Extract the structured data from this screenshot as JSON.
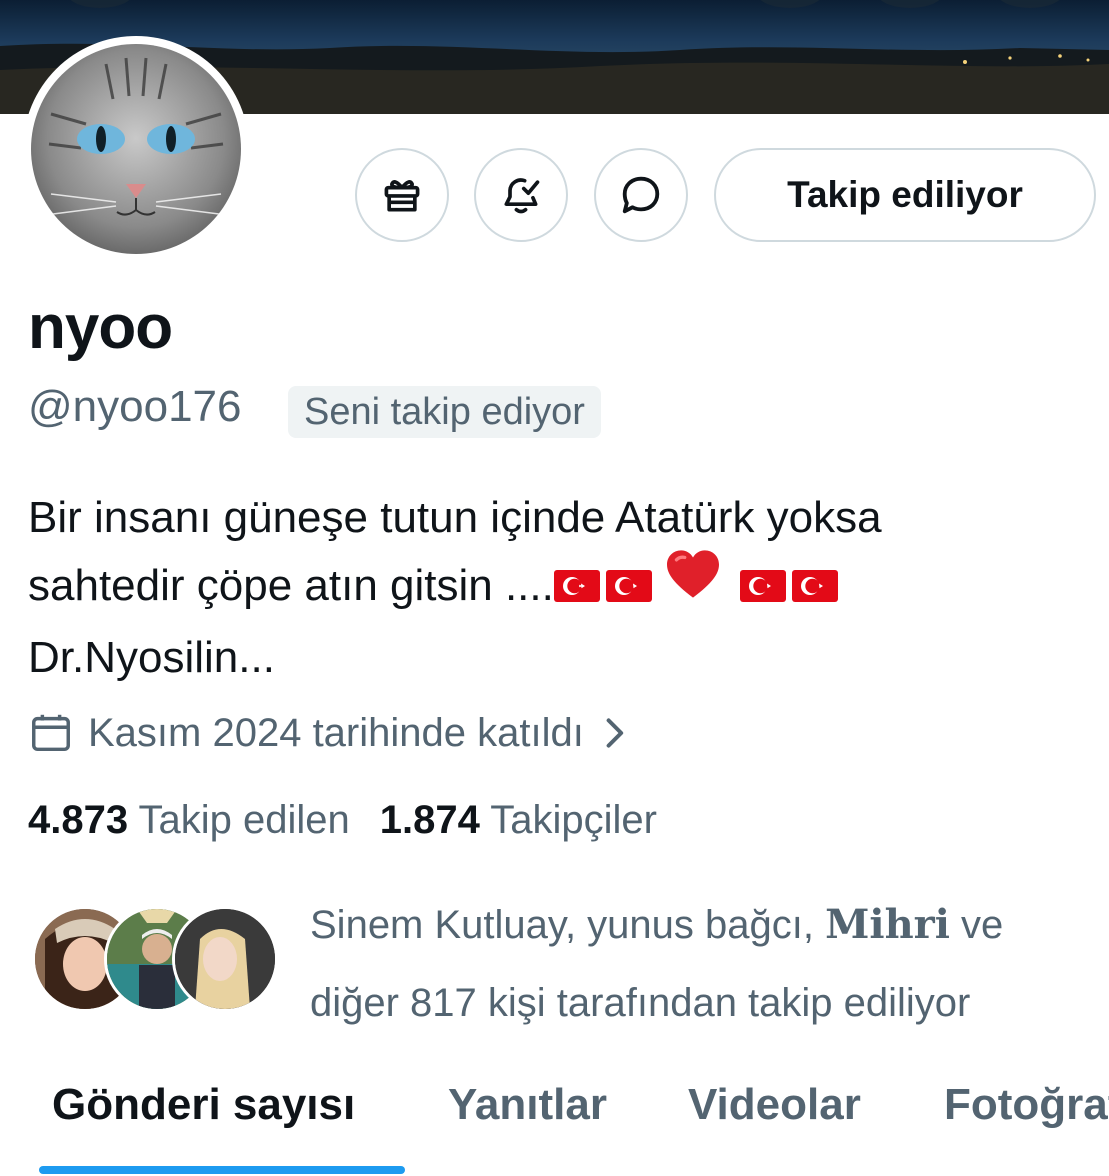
{
  "profile": {
    "display_name": "nyoo",
    "handle": "@nyoo176",
    "follows_you_badge": "Seni takip ediyor",
    "bio_lines": [
      "Bir insanı güneşe tutun içinde Atatürk yoksa",
      "sahtedir çöpe atın gitsin ....",
      "Dr.Nyosilin..."
    ],
    "bio_emoji": [
      "turkish-flag",
      "turkish-flag",
      "red-heart",
      "turkish-flag",
      "turkish-flag"
    ],
    "joined": "Kasım 2024 tarihinde katıldı",
    "following_count": "4.873",
    "following_label": "Takip edilen",
    "followers_count": "1.874",
    "followers_label": "Takipçiler"
  },
  "actions": {
    "follow_button_label": "Takip ediliyor",
    "icons": [
      "gift-icon",
      "bell-check-icon",
      "message-icon"
    ]
  },
  "followed_by": {
    "name1": "Sinem Kutluay, yunus bağcı, ",
    "name2": "Mihri",
    "after_names": " ve",
    "line2": "diğer 817 kişi tarafından takip ediliyor"
  },
  "tabs": [
    {
      "label": "Gönderi sayısı",
      "active": true
    },
    {
      "label": "Yanıtlar"
    },
    {
      "label": "Videolar"
    },
    {
      "label": "Fotoğraflar"
    }
  ],
  "colors": {
    "accent": "#1d9bf0",
    "text_primary": "#0f1419",
    "text_secondary": "#536471",
    "border": "#cfd9de",
    "badge_bg": "#eff3f4",
    "flag_red": "#e30a17"
  }
}
